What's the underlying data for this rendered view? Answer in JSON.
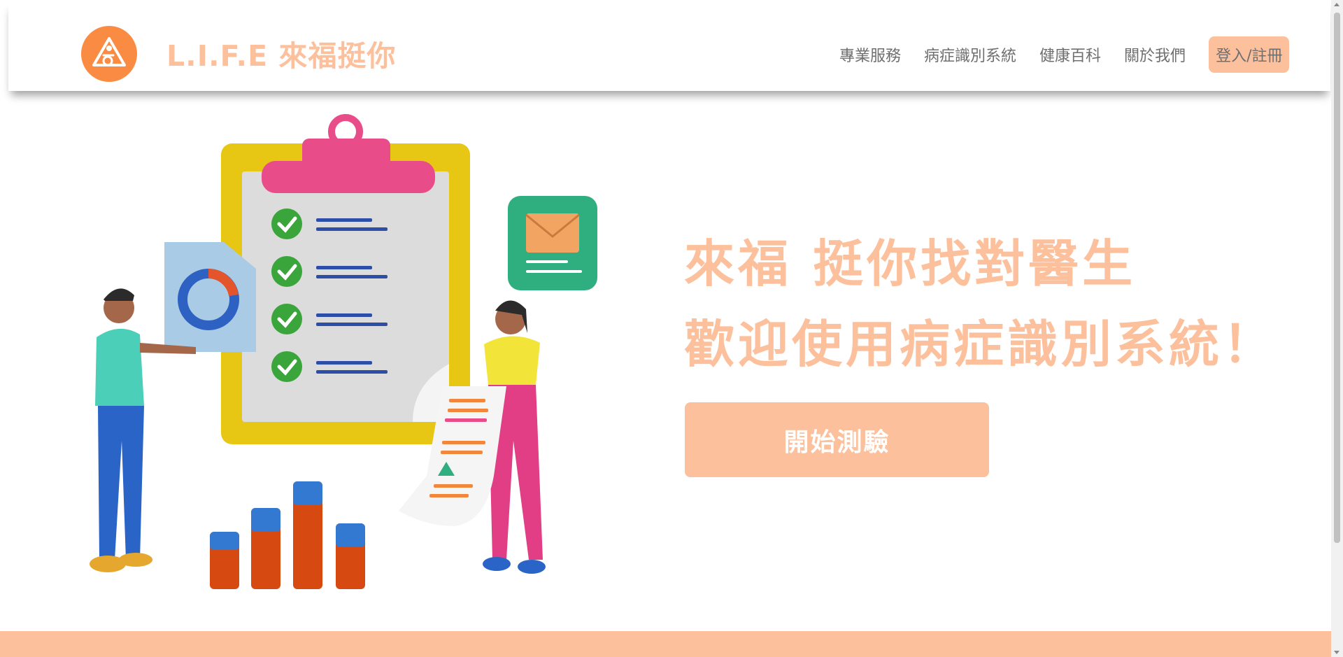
{
  "header": {
    "brand": "L.I.F.E 來福挺你",
    "nav": [
      "專業服務",
      "病症識別系統",
      "健康百科",
      "關於我們"
    ],
    "login_label": "登入/註冊"
  },
  "hero": {
    "headline_line1": "來福 挺你找對醫生",
    "headline_line2": "歡迎使用病症識別系統！",
    "cta_label": "開始測驗"
  },
  "colors": {
    "accent": "#fcc19c",
    "logo_orange": "#f98b43",
    "nav_text": "#6f6f6f"
  },
  "icons": [
    "logo-icon",
    "checklist-illustration",
    "mail-icon",
    "check-icon"
  ]
}
